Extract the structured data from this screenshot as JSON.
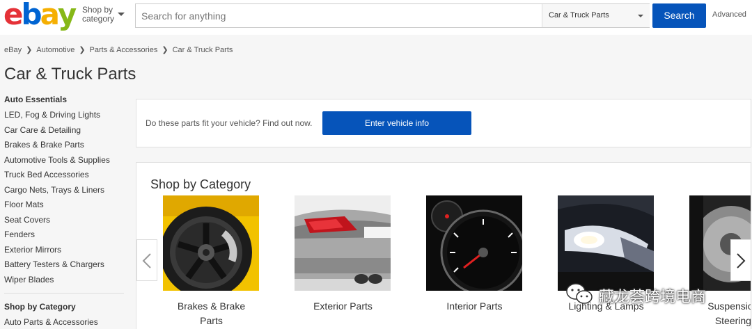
{
  "header": {
    "logo_letters": [
      {
        "char": "e",
        "color": "#e53238"
      },
      {
        "char": "b",
        "color": "#0064d2"
      },
      {
        "char": "a",
        "color": "#f5af02"
      },
      {
        "char": "y",
        "color": "#86b817"
      }
    ],
    "shop_by_line1": "Shop by",
    "shop_by_line2": "category",
    "search_placeholder": "Search for anything",
    "category_selected": "Car & Truck Parts",
    "search_button": "Search",
    "advanced_link": "Advanced"
  },
  "breadcrumb": [
    "eBay",
    "Automotive",
    "Parts & Accessories",
    "Car & Truck Parts"
  ],
  "page_title": "Car & Truck Parts",
  "sidebar": {
    "auto_essentials": {
      "heading": "Auto Essentials",
      "items": [
        "LED, Fog & Driving Lights",
        "Car Care & Detailing",
        "Brakes & Brake Parts",
        "Automotive Tools & Supplies",
        "Truck Bed Accessories",
        "Cargo Nets, Trays & Liners",
        "Floor Mats",
        "Seat Covers",
        "Fenders",
        "Exterior Mirrors",
        "Battery Testers & Chargers",
        "Wiper Blades"
      ]
    },
    "shop_by_category": {
      "heading": "Shop by Category",
      "items": [
        "Auto Parts & Accessories"
      ]
    }
  },
  "vehicle": {
    "prompt": "Do these parts fit your vehicle? Find out now.",
    "button": "Enter vehicle info"
  },
  "shop_by_category": {
    "title": "Shop by Category",
    "tiles": [
      {
        "line1": "Brakes & Brake",
        "line2": "Parts",
        "icon": "brake-rotor-image"
      },
      {
        "line1": "Exterior Parts",
        "line2": "",
        "icon": "car-rear-image"
      },
      {
        "line1": "Interior Parts",
        "line2": "",
        "icon": "speedometer-image"
      },
      {
        "line1": "Lighting & Lamps",
        "line2": "",
        "icon": "headlight-image"
      },
      {
        "line1": "Suspension &",
        "line2": "Steering P",
        "icon": "suspension-image"
      }
    ]
  },
  "watermark": {
    "text": "藏龙荟跨境电商"
  },
  "colors": {
    "brand_blue": "#0654ba",
    "background": "#f6f6f6"
  }
}
